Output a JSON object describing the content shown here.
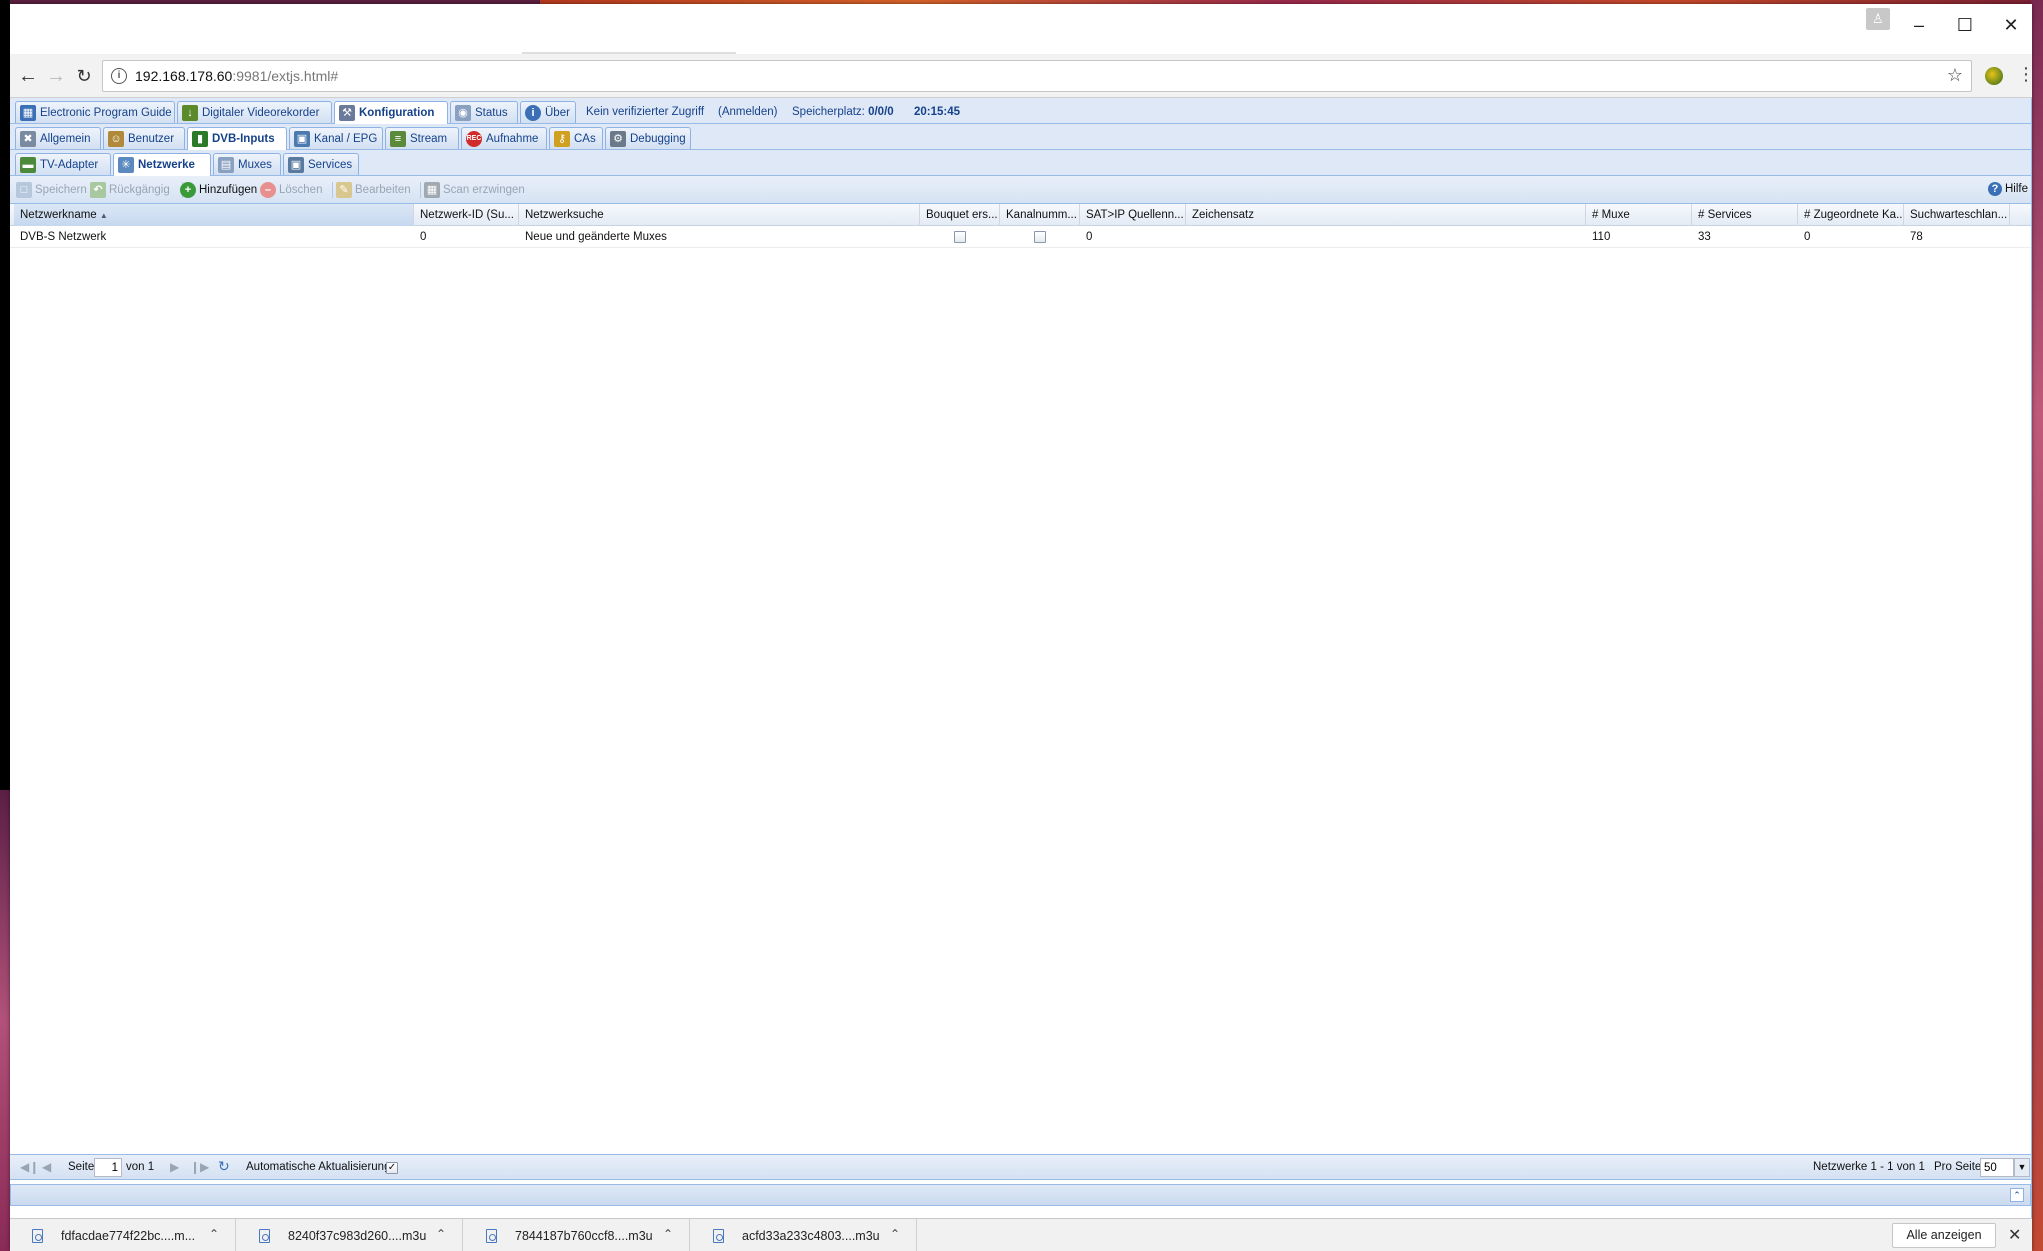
{
  "browser": {
    "url_host": "192.168.178.60",
    "url_rest": ":9981/extjs.html#"
  },
  "top_tabs": [
    {
      "label": "Electronic Program Guide",
      "icon": "epg-icon",
      "color": "#3b6fb6"
    },
    {
      "label": "Digitaler Videorekorder",
      "icon": "download-icon",
      "color": "#5a8a2a"
    },
    {
      "label": "Konfiguration",
      "icon": "wrench-icon",
      "color": "#6a7a9a",
      "active": true
    },
    {
      "label": "Status",
      "icon": "eye-icon",
      "color": "#8aa0c0"
    },
    {
      "label": "Über",
      "icon": "info-icon",
      "color": "#3b6fb6"
    }
  ],
  "status": {
    "access": "Kein verifizierter Zugriff",
    "login": "(Anmelden)",
    "storage_label": "Speicherplatz:",
    "storage_value": "0/0/0",
    "time": "20:15:45"
  },
  "config_tabs": [
    {
      "label": "Allgemein",
      "icon": "tools-icon",
      "color": "#7a8aa0"
    },
    {
      "label": "Benutzer",
      "icon": "users-icon",
      "color": "#b08a3a"
    },
    {
      "label": "DVB-Inputs",
      "icon": "card-icon",
      "color": "#2a7a2a",
      "active": true
    },
    {
      "label": "Kanal / EPG",
      "icon": "tv-icon",
      "color": "#4a7ab0"
    },
    {
      "label": "Stream",
      "icon": "stream-icon",
      "color": "#5a8a3a"
    },
    {
      "label": "Aufnahme",
      "icon": "rec-icon",
      "color": "#d02a2a"
    },
    {
      "label": "CAs",
      "icon": "key-icon",
      "color": "#d0a020"
    },
    {
      "label": "Debugging",
      "icon": "bug-icon",
      "color": "#6a7a8a"
    }
  ],
  "dvb_tabs": [
    {
      "label": "TV-Adapter",
      "icon": "adapter-icon",
      "color": "#4a8a3a"
    },
    {
      "label": "Netzwerke",
      "icon": "network-icon",
      "color": "#5a8ac0",
      "active": true
    },
    {
      "label": "Muxes",
      "icon": "mux-icon",
      "color": "#8aa0c0"
    },
    {
      "label": "Services",
      "icon": "services-icon",
      "color": "#5a7aa0"
    }
  ],
  "toolbar": {
    "save": "Speichern",
    "undo": "Rückgängig",
    "add": "Hinzufügen",
    "delete": "Löschen",
    "edit": "Bearbeiten",
    "force_scan": "Scan erzwingen",
    "help": "Hilfe"
  },
  "grid": {
    "columns": [
      "Netzwerkname",
      "Netzwerk-ID (Su...",
      "Netzwerksuche",
      "Bouquet ers...",
      "Kanalnumm...",
      "SAT>IP Quellenn...",
      "Zeichensatz",
      "# Muxe",
      "# Services",
      "# Zugeordnete Ka...",
      "Suchwarteschlan..."
    ],
    "rows": [
      {
        "name": "DVB-S Netzwerk",
        "network_id": "0",
        "search": "Neue und geänderte Muxes",
        "bouquet": false,
        "channel_numbers": false,
        "satip": "0",
        "charset": "",
        "muxes": "110",
        "services": "33",
        "assigned": "0",
        "queue": "78"
      }
    ]
  },
  "pager": {
    "page_label": "Seite",
    "page_value": "1",
    "of_label": "von 1",
    "auto_refresh": "Automatische Aktualisierung",
    "summary": "Netzwerke 1 - 1 von 1",
    "per_page_label": "Pro Seite",
    "per_page_value": "50"
  },
  "downloads": {
    "items": [
      "fdfacdae774f22bc....m...",
      "8240f37c983d260....m3u",
      "7844187b760ccf8....m3u",
      "acfd33a233c4803....m3u"
    ],
    "show_all": "Alle anzeigen"
  }
}
